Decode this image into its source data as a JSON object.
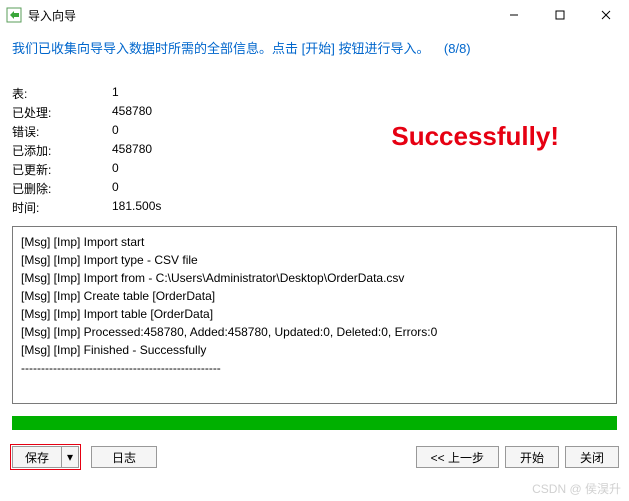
{
  "window": {
    "title": "导入向导"
  },
  "instruction": {
    "message": "我们已收集向导导入数据时所需的全部信息。点击 [开始] 按钮进行导入。",
    "step": "(8/8)"
  },
  "stats": {
    "labels": {
      "tables": "表:",
      "processed": "已处理:",
      "errors": "错误:",
      "added": "已添加:",
      "updated": "已更新:",
      "deleted": "已删除:",
      "time": "时间:"
    },
    "values": {
      "tables": "1",
      "processed": "458780",
      "errors": "0",
      "added": "458780",
      "updated": "0",
      "deleted": "0",
      "time": "181.500s"
    }
  },
  "overlay": {
    "success": "Successfully!"
  },
  "log_lines": [
    "[Msg] [Imp] Import start",
    "[Msg] [Imp] Import type - CSV file",
    "[Msg] [Imp] Import from - C:\\Users\\Administrator\\Desktop\\OrderData.csv",
    "[Msg] [Imp] Create table [OrderData]",
    "[Msg] [Imp] Import table [OrderData]",
    "[Msg] [Imp] Processed:458780, Added:458780, Updated:0, Deleted:0, Errors:0",
    "[Msg] [Imp] Finished - Successfully",
    "--------------------------------------------------"
  ],
  "buttons": {
    "save": "保存",
    "dropdown": "▾",
    "log": "日志",
    "prev": "<< 上一步",
    "start": "开始",
    "close": "关闭"
  },
  "watermark": "CSDN @ 侯淏升"
}
